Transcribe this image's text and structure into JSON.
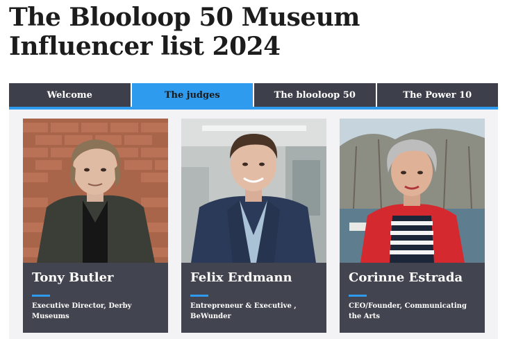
{
  "page": {
    "title_line1": "The Blooloop 50 Museum",
    "title_line2": "Influencer list 2024"
  },
  "tabs": [
    {
      "label": "Welcome",
      "active": false
    },
    {
      "label": "The judges",
      "active": true
    },
    {
      "label": "The blooloop 50",
      "active": false
    },
    {
      "label": "The Power 10",
      "active": false
    }
  ],
  "judges": [
    {
      "name": "Tony Butler",
      "role": "Executive Director, Derby Museums"
    },
    {
      "name": "Felix Erdmann",
      "role": "Entrepreneur & Executive , BeWunder"
    },
    {
      "name": "Corinne Estrada",
      "role": "CEO/Founder, Communicating the Arts"
    }
  ],
  "colors": {
    "accent": "#2f9bef",
    "tab_bg": "#3d3f4a",
    "card_bg": "#42444f"
  }
}
